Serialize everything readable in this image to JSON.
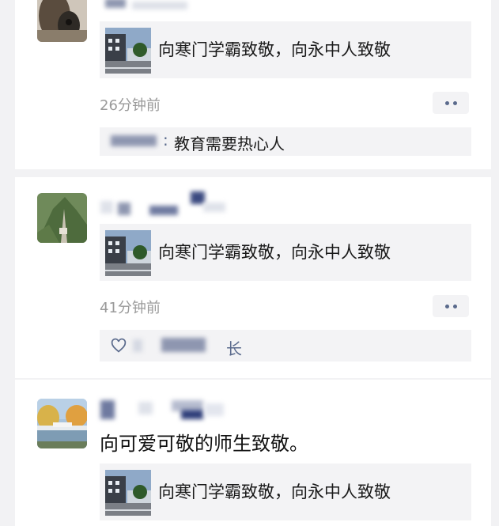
{
  "feed": {
    "posts": [
      {
        "link_title": "向寒门学霸致敬，向永中人致敬",
        "time": "26分钟前",
        "comment": {
          "separator": ":",
          "text": "教育需要热心人"
        }
      },
      {
        "link_title": "向寒门学霸致敬，向永中人致敬",
        "time": "41分钟前",
        "likes_suffix": "长"
      },
      {
        "text": "向可爱可敬的师生致敬。",
        "link_title": "向寒门学霸致敬，向永中人致敬"
      }
    ]
  },
  "colors": {
    "page_bg": "#f2f2f4",
    "card_bg": "#ffffff",
    "muted_box": "#f3f3f5",
    "timestamp": "#9a9a9a",
    "link_blue": "#5a6a8c"
  },
  "icons": [
    "more-dots-icon",
    "heart-outline-icon"
  ]
}
